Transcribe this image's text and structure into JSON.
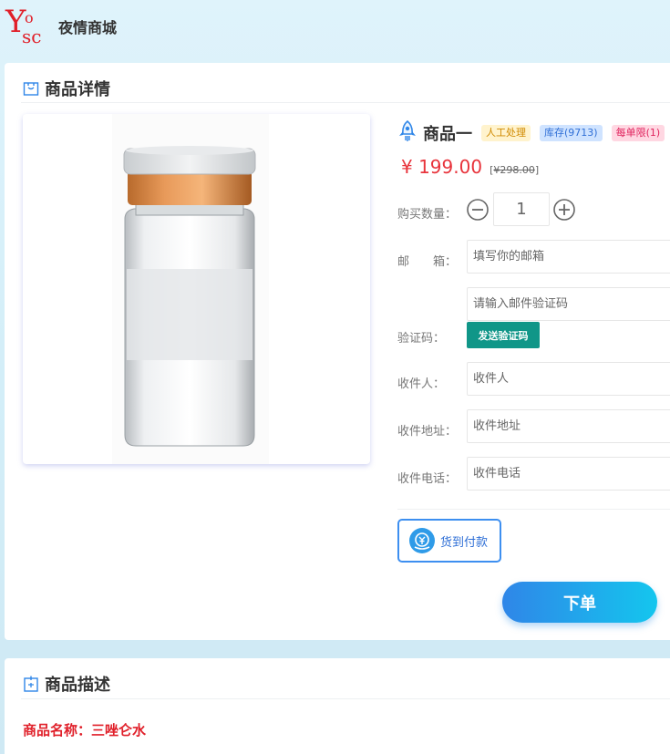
{
  "header": {
    "site_name": "夜情商城"
  },
  "detail_card": {
    "title": "商品详情",
    "product_name": "商品一",
    "tags": {
      "manual": "人工处理",
      "stock": "库存(9713)",
      "limit": "每单限(1)"
    },
    "price": "¥ 199.00",
    "old_price": "¥298.00",
    "form": {
      "quantity_label": "购买数量：",
      "quantity_value": "1",
      "email_label": "邮　　箱：",
      "email_placeholder": "填写你的邮箱",
      "code_label": "验证码：",
      "code_placeholder": "请输入邮件验证码",
      "send_code_button": "发送验证码",
      "recipient_label": "收件人：",
      "recipient_placeholder": "收件人",
      "address_label": "收件地址：",
      "address_placeholder": "收件地址",
      "phone_label": "收件电话：",
      "phone_placeholder": "收件电话"
    },
    "payment_option": "货到付款",
    "order_button": "下单"
  },
  "desc_card": {
    "title": "商品描述",
    "product_name_line": "商品名称：三唑仑水"
  },
  "colors": {
    "accent_blue": "#2f86e8",
    "price_red": "#e8343c",
    "send_button_green": "#109688"
  }
}
